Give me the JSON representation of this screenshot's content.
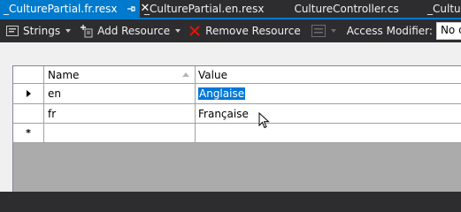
{
  "tabs": [
    {
      "label": "_CulturePartial.fr.resx",
      "active": true
    },
    {
      "label": "_CulturePartial.en.resx",
      "active": false
    },
    {
      "label": "CultureController.cs",
      "active": false
    },
    {
      "label": "_Culture",
      "active": false
    }
  ],
  "toolbar": {
    "strings_label": "Strings",
    "add_resource_label": "Add Resource",
    "remove_resource_label": "Remove Resource",
    "access_modifier_label": "Access Modifier:",
    "access_modifier_value": "No code g"
  },
  "grid": {
    "columns": [
      "Name",
      "Value"
    ],
    "rows": [
      {
        "name": "en",
        "value": "Anglaise"
      },
      {
        "name": "fr",
        "value": "Française"
      }
    ],
    "new_row_marker": "*"
  },
  "colors": {
    "accent": "#007acc",
    "selection": "#0078d7",
    "toolbar_bg": "#2d2d30"
  }
}
